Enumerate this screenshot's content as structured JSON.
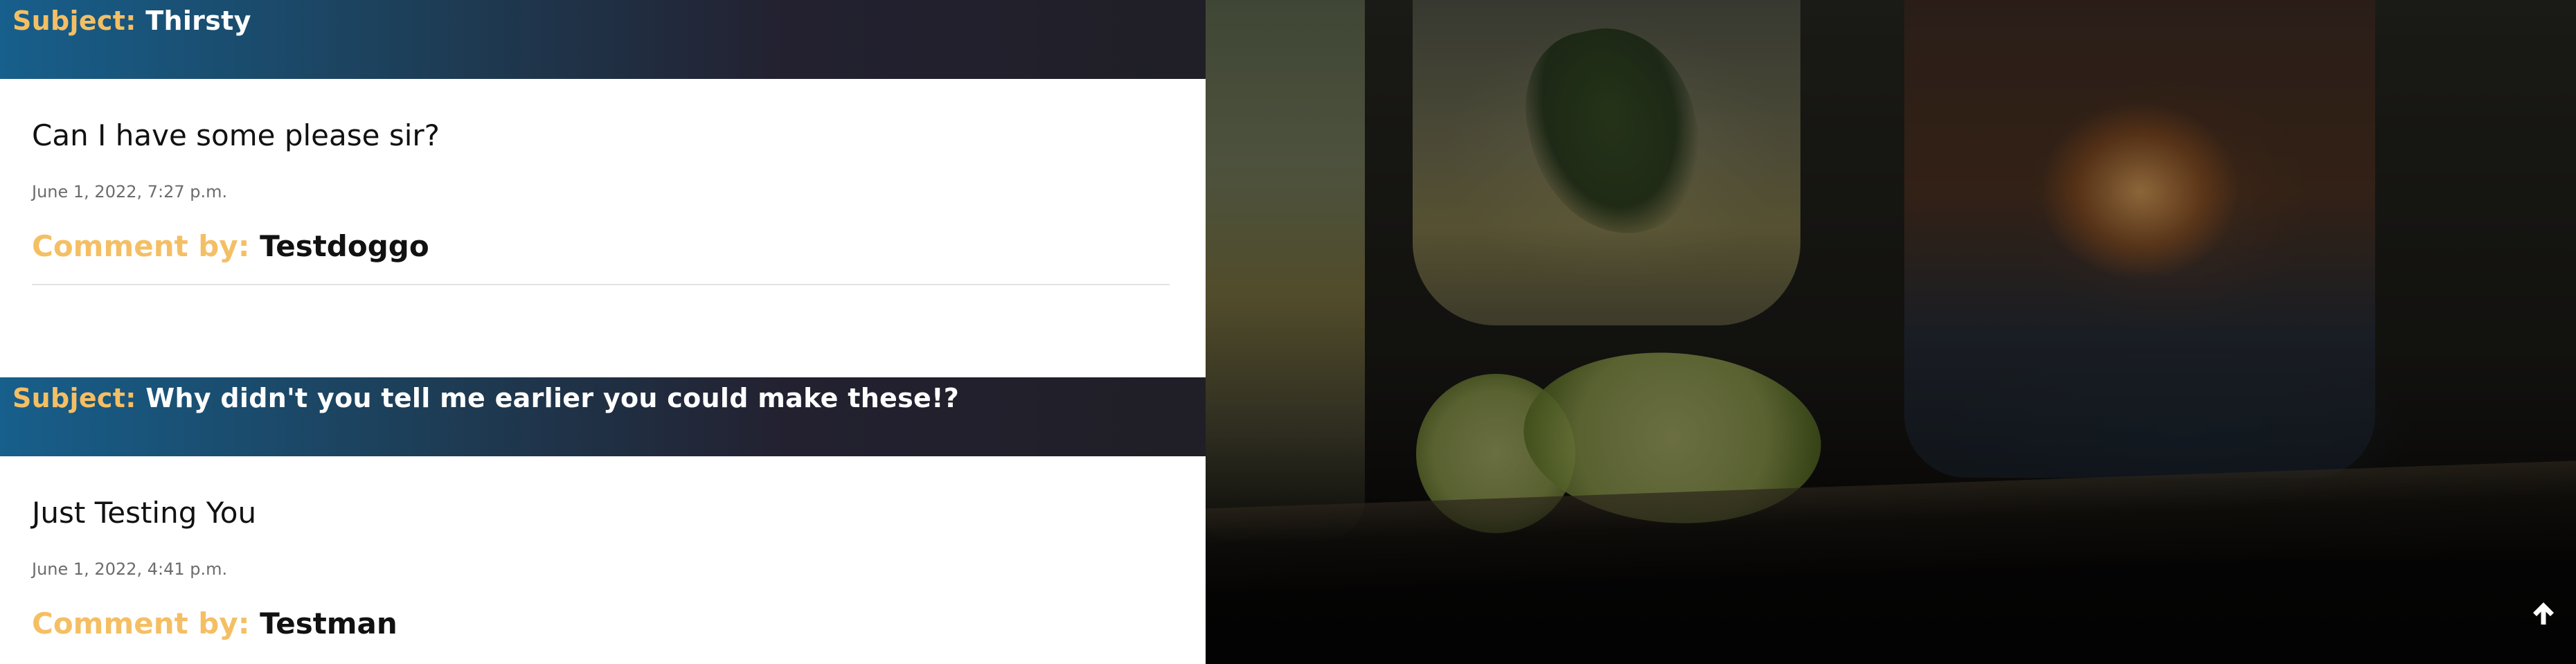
{
  "comments": [
    {
      "subject_label": "Subject:",
      "subject": "Thirsty",
      "text": "Can I have some please sir?",
      "date": "June 1, 2022, 7:27 p.m.",
      "author_label": "Comment by:",
      "author": "Testdoggo"
    },
    {
      "subject_label": "Subject:",
      "subject": "Why didn't you tell me earlier you could make these!?",
      "text": "Just Testing You",
      "date": "June 1, 2022, 4:41 p.m.",
      "author_label": "Comment by:",
      "author": "Testman"
    }
  ],
  "colors": {
    "accent": "#f4bf64",
    "header_start": "#175f8c",
    "header_end": "#201f27"
  },
  "back_to_top": {
    "icon": "arrow-up-icon"
  }
}
